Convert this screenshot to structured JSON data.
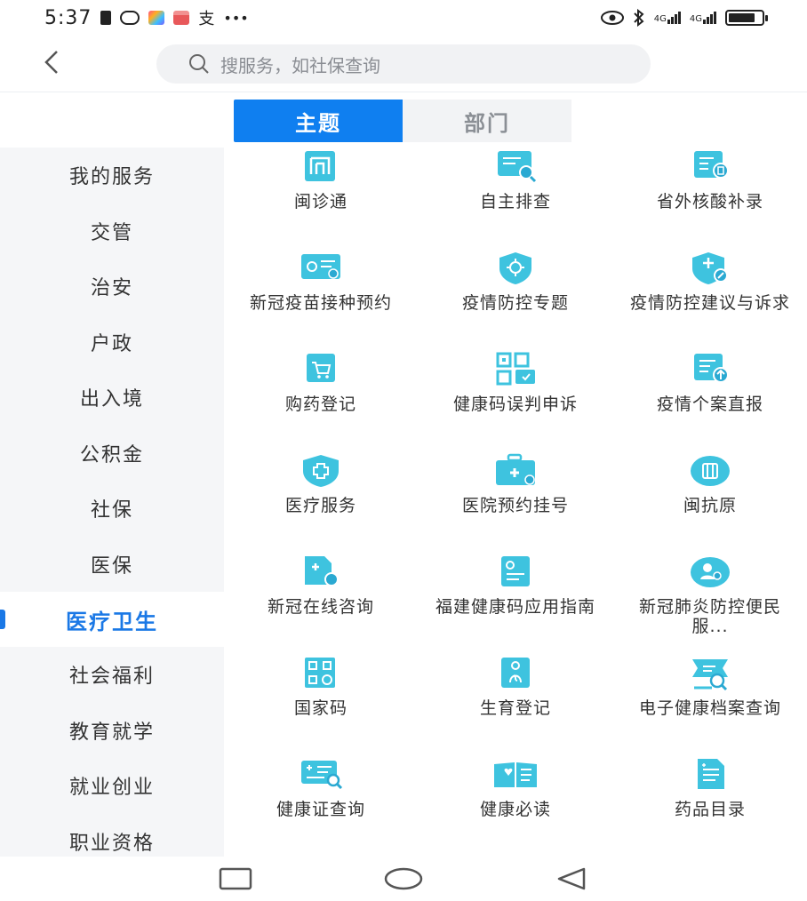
{
  "status": {
    "time": "5:37",
    "notification_icons": [
      "sim-icon",
      "app-icon",
      "colorful-app-icon",
      "gift-icon",
      "alipay-icon",
      "more-dots-icon"
    ],
    "right_icons": [
      "eye-icon",
      "bluetooth-icon",
      "signal-4g-icon",
      "signal-4g-icon",
      "battery-icon"
    ],
    "net1": "4G",
    "net2": "4G",
    "battery_level": 0.8
  },
  "header": {
    "search_placeholder": "搜服务，如社保查询"
  },
  "tabs": [
    {
      "label": "主题",
      "active": true
    },
    {
      "label": "部门",
      "active": false
    }
  ],
  "sidebar": {
    "items": [
      {
        "label": "我的服务"
      },
      {
        "label": "交管"
      },
      {
        "label": "治安"
      },
      {
        "label": "户政"
      },
      {
        "label": "出入境"
      },
      {
        "label": "公积金"
      },
      {
        "label": "社保"
      },
      {
        "label": "医保"
      },
      {
        "label": "医疗卫生",
        "active": true
      },
      {
        "label": "社会福利"
      },
      {
        "label": "教育就学"
      },
      {
        "label": "就业创业"
      },
      {
        "label": "职业资格"
      }
    ]
  },
  "services": [
    {
      "label": "闽诊通",
      "icon": "min-zhen-tong-icon"
    },
    {
      "label": "自主排查",
      "icon": "self-check-icon"
    },
    {
      "label": "省外核酸补录",
      "icon": "nucleic-acid-icon"
    },
    {
      "label": "新冠疫苗接种预约",
      "icon": "vaccine-icon"
    },
    {
      "label": "疫情防控专题",
      "icon": "virus-shield-icon"
    },
    {
      "label": "疫情防控建议与诉求",
      "icon": "suggestion-shield-icon"
    },
    {
      "label": "购药登记",
      "icon": "medicine-cart-icon"
    },
    {
      "label": "健康码误判申诉",
      "icon": "qr-code-icon"
    },
    {
      "label": "疫情个案直报",
      "icon": "report-upload-icon"
    },
    {
      "label": "医疗服务",
      "icon": "medical-shield-icon"
    },
    {
      "label": "医院预约挂号",
      "icon": "medical-kit-icon"
    },
    {
      "label": "闽抗原",
      "icon": "antigen-icon"
    },
    {
      "label": "新冠在线咨询",
      "icon": "online-consult-icon"
    },
    {
      "label": "福建健康码应用指南",
      "icon": "guide-icon"
    },
    {
      "label": "新冠肺炎防控便民服...",
      "icon": "person-shield-icon"
    },
    {
      "label": "国家码",
      "icon": "national-qr-icon"
    },
    {
      "label": "生育登记",
      "icon": "birth-icon"
    },
    {
      "label": "电子健康档案查询",
      "icon": "health-record-icon"
    },
    {
      "label": "健康证查询",
      "icon": "health-cert-icon"
    },
    {
      "label": "健康必读",
      "icon": "book-icon"
    },
    {
      "label": "药品目录",
      "icon": "drug-list-icon"
    }
  ],
  "colors": {
    "accent": "#0f7ff0",
    "icon_teal": "#2cc0d8",
    "icon_blue": "#3aa8e8",
    "sidebar_bg": "#f5f6f8"
  },
  "navbar": {
    "buttons": [
      "recent-apps-icon",
      "home-icon",
      "back-nav-icon"
    ]
  }
}
